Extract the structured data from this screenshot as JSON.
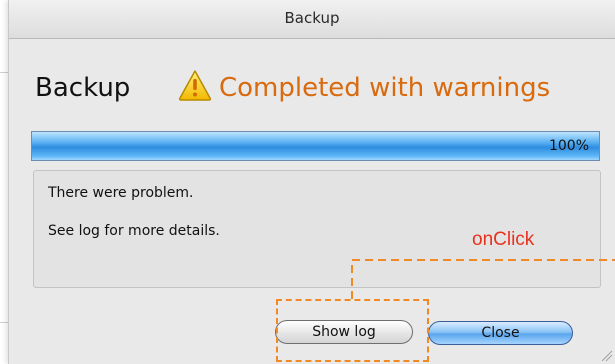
{
  "window": {
    "title": "Backup"
  },
  "heading": {
    "main": "Backup",
    "status": "Completed with warnings",
    "status_color": "#d96a0e",
    "icon": "warning-icon"
  },
  "progress": {
    "value": 1.0,
    "label": "100%"
  },
  "message": {
    "line1": "There were problem.",
    "line2": "See log for more details."
  },
  "buttons": {
    "show_log": "Show log",
    "close": "Close"
  },
  "annotation": {
    "label": "onClick",
    "color": "#f08a24",
    "label_color": "#e8321e"
  }
}
